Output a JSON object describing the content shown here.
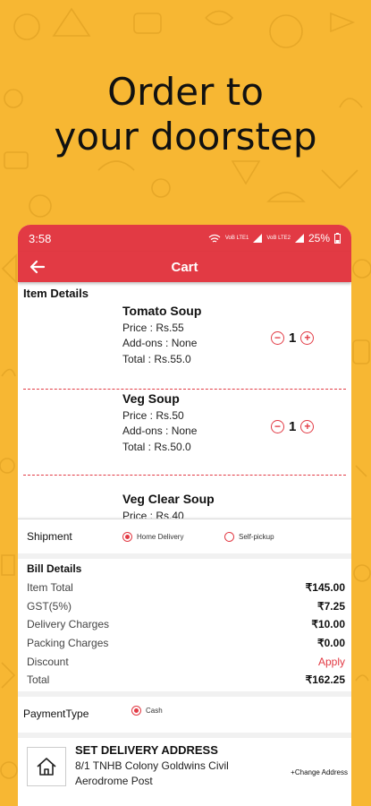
{
  "promo": {
    "headline_line1": "Order to",
    "headline_line2": "your doorstep"
  },
  "status_bar": {
    "time": "3:58",
    "network1": "VoB LTE1",
    "network2": "VoB LTE2",
    "battery": "25%"
  },
  "app_bar": {
    "title": "Cart"
  },
  "cart": {
    "section_title": "Item Details",
    "items": [
      {
        "name": "Tomato Soup",
        "price": "Price : Rs.55",
        "addons": "Add-ons : None",
        "total": "Total : Rs.55.0",
        "qty": "1"
      },
      {
        "name": "Veg Soup",
        "price": "Price : Rs.50",
        "addons": "Add-ons : None",
        "total": "Total : Rs.50.0",
        "qty": "1"
      },
      {
        "name": "Veg Clear Soup",
        "price": "Price : Rs.40"
      }
    ]
  },
  "shipment": {
    "label": "Shipment",
    "option_home": "Home Delivery",
    "option_self": "Self-pickup",
    "selected": "home"
  },
  "bill": {
    "title": "Bill Details",
    "rows": [
      {
        "label": "Item Total",
        "value": "₹145.00"
      },
      {
        "label": "GST(5%)",
        "value": "₹7.25"
      },
      {
        "label": "Delivery Charges",
        "value": "₹10.00"
      },
      {
        "label": "Packing Charges",
        "value": "₹0.00"
      },
      {
        "label": "Discount",
        "value": "Apply"
      },
      {
        "label": "Total",
        "value": "₹162.25"
      }
    ]
  },
  "payment": {
    "label": "PaymentType",
    "option_cash": "Cash"
  },
  "delivery": {
    "title": "SET DELIVERY ADDRESS",
    "line1": "8/1  TNHB Colony  Goldwins  Civil",
    "line2": "Aerodrome Post",
    "change_label": "+Change Address"
  },
  "colors": {
    "background": "#f7b733",
    "accent": "#e23a44"
  },
  "icons": [
    "back-arrow-icon",
    "wifi-icon",
    "signal-icon",
    "battery-icon",
    "minus-icon",
    "plus-icon",
    "home-icon"
  ]
}
